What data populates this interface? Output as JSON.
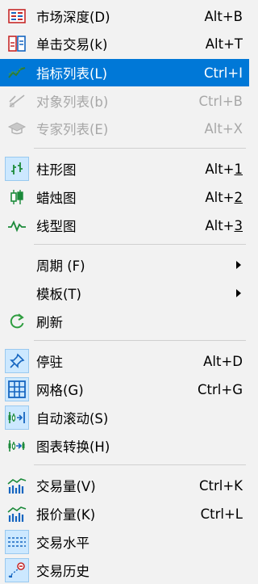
{
  "items": [
    {
      "label": "市场深度(D)",
      "shortcut": "Alt+B",
      "icon": "market-depth-icon"
    },
    {
      "label": "单击交易(k)",
      "shortcut": "Alt+T",
      "icon": "one-click-trading-icon"
    },
    {
      "label": "指标列表(L)",
      "shortcut": "Ctrl+I",
      "icon": "indicators-list-icon",
      "selected": true
    },
    {
      "label": "对象列表(b)",
      "shortcut": "Ctrl+B",
      "icon": "objects-list-icon",
      "disabled": true
    },
    {
      "label": "专家列表(E)",
      "shortcut": "Alt+X",
      "icon": "experts-list-icon",
      "disabled": true
    },
    {
      "label": "柱形图",
      "shortcut_prefix": "Alt+",
      "shortcut_key": "1",
      "icon": "bar-chart-icon",
      "checked": true
    },
    {
      "label": "蜡烛图",
      "shortcut_prefix": "Alt+",
      "shortcut_key": "2",
      "icon": "candlestick-icon"
    },
    {
      "label": "线型图",
      "shortcut_prefix": "Alt+",
      "shortcut_key": "3",
      "icon": "line-chart-icon"
    },
    {
      "label": "周期 (F)",
      "submenu": true
    },
    {
      "label": "模板(T)",
      "submenu": true
    },
    {
      "label": "刷新",
      "icon": "refresh-icon"
    },
    {
      "label": "停驻",
      "shortcut": "Alt+D",
      "icon": "pin-icon",
      "checked": true
    },
    {
      "label": "网格(G)",
      "shortcut": "Ctrl+G",
      "icon": "grid-icon",
      "checked": true
    },
    {
      "label": "自动滚动(S)",
      "icon": "auto-scroll-icon",
      "checked": true
    },
    {
      "label": "图表转换(H)",
      "icon": "chart-shift-icon"
    },
    {
      "label": "交易量(V)",
      "shortcut": "Ctrl+K",
      "icon": "volume-icon"
    },
    {
      "label": "报价量(K)",
      "shortcut": "Ctrl+L",
      "icon": "tick-volume-icon"
    },
    {
      "label": "交易水平",
      "icon": "trade-levels-icon",
      "checked": true
    },
    {
      "label": "交易历史",
      "icon": "trade-history-icon",
      "checked": true
    }
  ]
}
